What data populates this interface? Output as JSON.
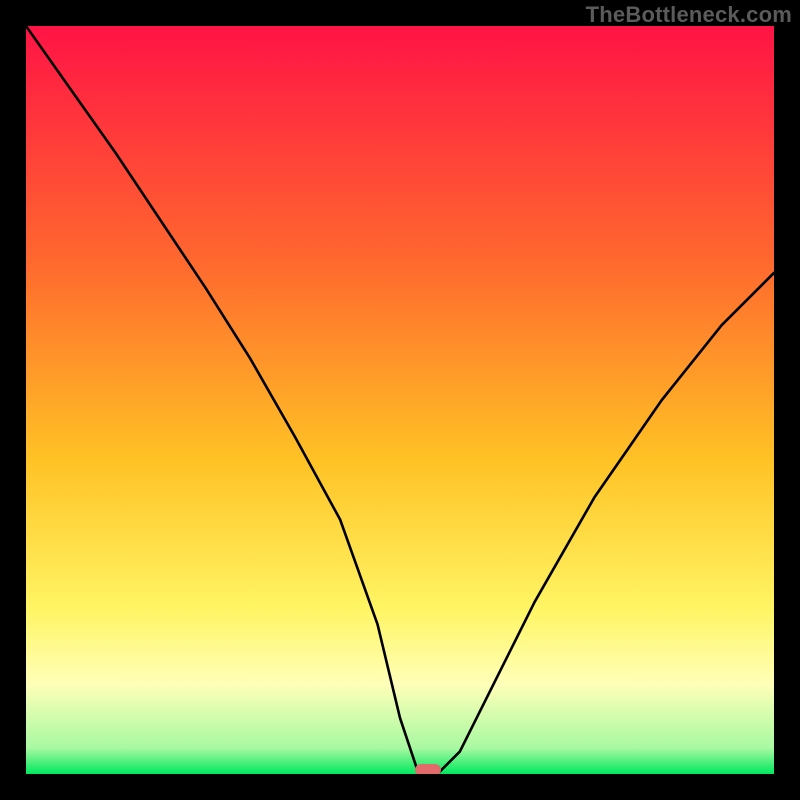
{
  "watermark": "TheBottleneck.com",
  "colors": {
    "top": "#ff1345",
    "mid1": "#ff6a2e",
    "mid2": "#ffc225",
    "mid3": "#fff564",
    "mid4": "#ffffb8",
    "green": "#00e85e",
    "curve": "#000000",
    "marker": "#e26a6a",
    "bg": "#000000"
  },
  "chart_data": {
    "type": "line",
    "title": "",
    "xlabel": "",
    "ylabel": "",
    "xlim": [
      0,
      1
    ],
    "ylim": [
      0,
      1
    ],
    "x": [
      0.0,
      0.06,
      0.12,
      0.18,
      0.24,
      0.3,
      0.36,
      0.42,
      0.47,
      0.5,
      0.525,
      0.55,
      0.58,
      0.62,
      0.68,
      0.76,
      0.85,
      0.93,
      1.0
    ],
    "values": [
      1.0,
      0.915,
      0.83,
      0.74,
      0.65,
      0.555,
      0.45,
      0.34,
      0.2,
      0.075,
      0.0,
      0.0,
      0.03,
      0.11,
      0.23,
      0.37,
      0.5,
      0.6,
      0.67
    ],
    "marker": {
      "x": 0.537,
      "y": 0.0
    },
    "gradient_stops": [
      {
        "pos": 0.0,
        "color": "#ff1345"
      },
      {
        "pos": 0.32,
        "color": "#ff6a2e"
      },
      {
        "pos": 0.58,
        "color": "#ffc225"
      },
      {
        "pos": 0.78,
        "color": "#fff564"
      },
      {
        "pos": 0.88,
        "color": "#ffffb8"
      },
      {
        "pos": 0.965,
        "color": "#a8f9a1"
      },
      {
        "pos": 1.0,
        "color": "#00e85e"
      }
    ]
  }
}
